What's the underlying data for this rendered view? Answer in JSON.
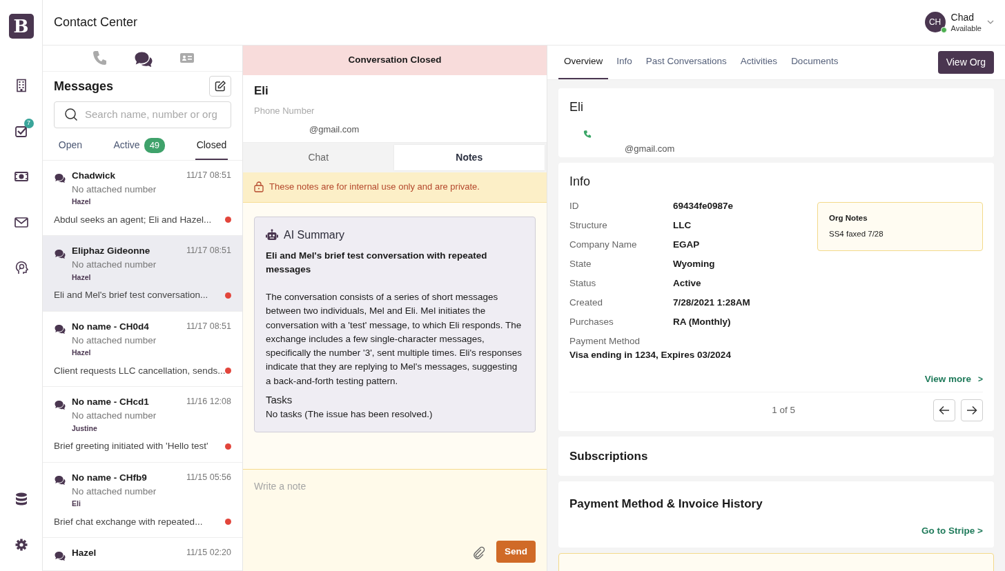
{
  "app": {
    "logo": "B",
    "title": "Contact Center"
  },
  "nav_rail": {
    "tasks_badge": "7"
  },
  "user": {
    "initials": "CH",
    "name": "Chad",
    "status": "Available",
    "online": true
  },
  "channels": [
    {
      "kind": "phone",
      "selected": false
    },
    {
      "kind": "chat",
      "selected": true
    },
    {
      "kind": "contact",
      "selected": false
    }
  ],
  "messages": {
    "title": "Messages",
    "search": {
      "placeholder": "Search name, number or org"
    },
    "filters": [
      {
        "label": "Open",
        "selected": false
      },
      {
        "label": "Active",
        "count": "49",
        "selected": false
      },
      {
        "label": "Closed",
        "selected": true
      }
    ],
    "conversations": [
      {
        "name": "Chadwick",
        "time": "11/17 08:51",
        "number": "No attached number",
        "agent": "Hazel",
        "summary": "Abdul seeks an agent; Eli and Hazel...",
        "unread": true,
        "selected": false
      },
      {
        "name": "Eliphaz Gideonne",
        "time": "11/17 08:51",
        "number": "No attached number",
        "agent": "Hazel",
        "summary": "Eli and Mel's brief test conversation...",
        "unread": true,
        "selected": true
      },
      {
        "name": "No name - CH0d4",
        "time": "11/17 08:51",
        "number": "No attached number",
        "agent": "Hazel",
        "summary": "Client requests LLC cancellation, sends...",
        "unread": true,
        "selected": false
      },
      {
        "name": "No name - CHcd1",
        "time": "11/16 12:08",
        "number": "No attached number",
        "agent": "Justine",
        "summary": "Brief greeting initiated with 'Hello test'",
        "unread": true,
        "selected": false
      },
      {
        "name": "No name - CHfb9",
        "time": "11/15 05:56",
        "number": "No attached number",
        "agent": "Eli",
        "summary": "Brief chat exchange with repeated...",
        "unread": true,
        "selected": false
      },
      {
        "name": "Hazel",
        "time": "11/15 02:20",
        "selected": false
      }
    ]
  },
  "conversation": {
    "banner": "Conversation Closed",
    "name": "Eli",
    "phone_label": "Phone Number",
    "email": "@gmail.com",
    "tabs": [
      {
        "label": "Chat",
        "selected": false
      },
      {
        "label": "Notes",
        "selected": true
      }
    ],
    "notice": "These notes are for internal use only and are private.",
    "summary": {
      "title": "AI Summary",
      "heading": "Eli and Mel's brief test conversation with repeated messages",
      "body": "The conversation consists of a series of short messages between two individuals, Mel and Eli. Mel initiates the conversation with a 'test' message, to which Eli responds. The exchange includes a few single-character messages, specifically the number '3', sent multiple times. Eli's responses indicate that they are replying to Mel's messages, suggesting a back-and-forth testing pattern.",
      "tasks_title": "Tasks",
      "tasks": "No tasks (The issue has been resolved.)"
    },
    "note": {
      "placeholder": "Write a note"
    },
    "send": "Send"
  },
  "details": {
    "tabs": [
      {
        "label": "Overview",
        "selected": true
      },
      {
        "label": "Info",
        "selected": false
      },
      {
        "label": "Past Conversations",
        "selected": false
      },
      {
        "label": "Activities",
        "selected": false
      },
      {
        "label": "Documents",
        "selected": false
      }
    ],
    "view_org": "View Org",
    "contact": {
      "name": "Eli",
      "email": "@gmail.com"
    },
    "info": {
      "title": "Info",
      "fields": [
        {
          "label": "ID",
          "value": "69434fe0987e"
        },
        {
          "label": "Structure",
          "value": "LLC"
        },
        {
          "label": "Company Name",
          "value": "EGAP"
        },
        {
          "label": "State",
          "value": "Wyoming"
        },
        {
          "label": "Status",
          "value": "Active"
        },
        {
          "label": "Created",
          "value": "7/28/2021 1:28AM"
        },
        {
          "label": "Purchases",
          "value": "RA (Monthly)"
        }
      ],
      "payment": {
        "label": "Payment Method",
        "value": "Visa ending in 1234, Expires 03/2024"
      },
      "org_notes": {
        "title": "Org Notes",
        "text": "SS4 faxed 7/28"
      },
      "view_more": "View more",
      "view_more_arrow": ">",
      "pager": "1 of 5"
    },
    "subscriptions": {
      "title": "Subscriptions"
    },
    "invoices": {
      "title": "Payment Method & Invoice History",
      "link": "Go to Stripe >"
    }
  }
}
